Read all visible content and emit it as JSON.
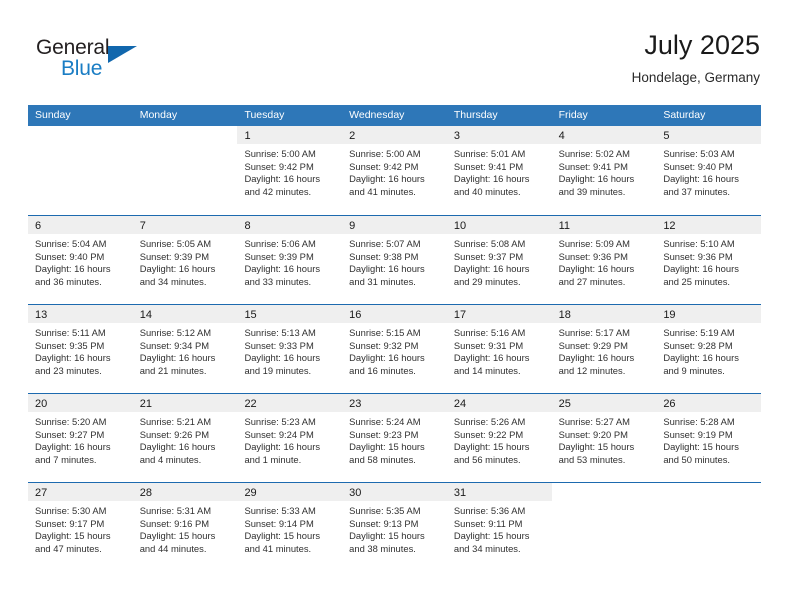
{
  "brand": {
    "name_top": "General",
    "name_bottom": "Blue",
    "accent_color": "#1a7dc4",
    "triangle_color": "#1167ad"
  },
  "header": {
    "title": "July 2025",
    "subtitle": "Hondelage, Germany"
  },
  "theme": {
    "header_blue": "#2e77b8",
    "rule_blue": "#1d6aaf",
    "daynum_band": "#efefef"
  },
  "labels": {
    "sunrise_prefix": "Sunrise:",
    "sunset_prefix": "Sunset:",
    "daylight_prefix": "Daylight:"
  },
  "weekdays": [
    "Sunday",
    "Monday",
    "Tuesday",
    "Wednesday",
    "Thursday",
    "Friday",
    "Saturday"
  ],
  "weeks": [
    [
      {
        "day": ""
      },
      {
        "day": ""
      },
      {
        "day": "1",
        "sunrise": "Sunrise: 5:00 AM",
        "sunset": "Sunset: 9:42 PM",
        "daylight": "Daylight: 16 hours and 42 minutes."
      },
      {
        "day": "2",
        "sunrise": "Sunrise: 5:00 AM",
        "sunset": "Sunset: 9:42 PM",
        "daylight": "Daylight: 16 hours and 41 minutes."
      },
      {
        "day": "3",
        "sunrise": "Sunrise: 5:01 AM",
        "sunset": "Sunset: 9:41 PM",
        "daylight": "Daylight: 16 hours and 40 minutes."
      },
      {
        "day": "4",
        "sunrise": "Sunrise: 5:02 AM",
        "sunset": "Sunset: 9:41 PM",
        "daylight": "Daylight: 16 hours and 39 minutes."
      },
      {
        "day": "5",
        "sunrise": "Sunrise: 5:03 AM",
        "sunset": "Sunset: 9:40 PM",
        "daylight": "Daylight: 16 hours and 37 minutes."
      }
    ],
    [
      {
        "day": "6",
        "sunrise": "Sunrise: 5:04 AM",
        "sunset": "Sunset: 9:40 PM",
        "daylight": "Daylight: 16 hours and 36 minutes."
      },
      {
        "day": "7",
        "sunrise": "Sunrise: 5:05 AM",
        "sunset": "Sunset: 9:39 PM",
        "daylight": "Daylight: 16 hours and 34 minutes."
      },
      {
        "day": "8",
        "sunrise": "Sunrise: 5:06 AM",
        "sunset": "Sunset: 9:39 PM",
        "daylight": "Daylight: 16 hours and 33 minutes."
      },
      {
        "day": "9",
        "sunrise": "Sunrise: 5:07 AM",
        "sunset": "Sunset: 9:38 PM",
        "daylight": "Daylight: 16 hours and 31 minutes."
      },
      {
        "day": "10",
        "sunrise": "Sunrise: 5:08 AM",
        "sunset": "Sunset: 9:37 PM",
        "daylight": "Daylight: 16 hours and 29 minutes."
      },
      {
        "day": "11",
        "sunrise": "Sunrise: 5:09 AM",
        "sunset": "Sunset: 9:36 PM",
        "daylight": "Daylight: 16 hours and 27 minutes."
      },
      {
        "day": "12",
        "sunrise": "Sunrise: 5:10 AM",
        "sunset": "Sunset: 9:36 PM",
        "daylight": "Daylight: 16 hours and 25 minutes."
      }
    ],
    [
      {
        "day": "13",
        "sunrise": "Sunrise: 5:11 AM",
        "sunset": "Sunset: 9:35 PM",
        "daylight": "Daylight: 16 hours and 23 minutes."
      },
      {
        "day": "14",
        "sunrise": "Sunrise: 5:12 AM",
        "sunset": "Sunset: 9:34 PM",
        "daylight": "Daylight: 16 hours and 21 minutes."
      },
      {
        "day": "15",
        "sunrise": "Sunrise: 5:13 AM",
        "sunset": "Sunset: 9:33 PM",
        "daylight": "Daylight: 16 hours and 19 minutes."
      },
      {
        "day": "16",
        "sunrise": "Sunrise: 5:15 AM",
        "sunset": "Sunset: 9:32 PM",
        "daylight": "Daylight: 16 hours and 16 minutes."
      },
      {
        "day": "17",
        "sunrise": "Sunrise: 5:16 AM",
        "sunset": "Sunset: 9:31 PM",
        "daylight": "Daylight: 16 hours and 14 minutes."
      },
      {
        "day": "18",
        "sunrise": "Sunrise: 5:17 AM",
        "sunset": "Sunset: 9:29 PM",
        "daylight": "Daylight: 16 hours and 12 minutes."
      },
      {
        "day": "19",
        "sunrise": "Sunrise: 5:19 AM",
        "sunset": "Sunset: 9:28 PM",
        "daylight": "Daylight: 16 hours and 9 minutes."
      }
    ],
    [
      {
        "day": "20",
        "sunrise": "Sunrise: 5:20 AM",
        "sunset": "Sunset: 9:27 PM",
        "daylight": "Daylight: 16 hours and 7 minutes."
      },
      {
        "day": "21",
        "sunrise": "Sunrise: 5:21 AM",
        "sunset": "Sunset: 9:26 PM",
        "daylight": "Daylight: 16 hours and 4 minutes."
      },
      {
        "day": "22",
        "sunrise": "Sunrise: 5:23 AM",
        "sunset": "Sunset: 9:24 PM",
        "daylight": "Daylight: 16 hours and 1 minute."
      },
      {
        "day": "23",
        "sunrise": "Sunrise: 5:24 AM",
        "sunset": "Sunset: 9:23 PM",
        "daylight": "Daylight: 15 hours and 58 minutes."
      },
      {
        "day": "24",
        "sunrise": "Sunrise: 5:26 AM",
        "sunset": "Sunset: 9:22 PM",
        "daylight": "Daylight: 15 hours and 56 minutes."
      },
      {
        "day": "25",
        "sunrise": "Sunrise: 5:27 AM",
        "sunset": "Sunset: 9:20 PM",
        "daylight": "Daylight: 15 hours and 53 minutes."
      },
      {
        "day": "26",
        "sunrise": "Sunrise: 5:28 AM",
        "sunset": "Sunset: 9:19 PM",
        "daylight": "Daylight: 15 hours and 50 minutes."
      }
    ],
    [
      {
        "day": "27",
        "sunrise": "Sunrise: 5:30 AM",
        "sunset": "Sunset: 9:17 PM",
        "daylight": "Daylight: 15 hours and 47 minutes."
      },
      {
        "day": "28",
        "sunrise": "Sunrise: 5:31 AM",
        "sunset": "Sunset: 9:16 PM",
        "daylight": "Daylight: 15 hours and 44 minutes."
      },
      {
        "day": "29",
        "sunrise": "Sunrise: 5:33 AM",
        "sunset": "Sunset: 9:14 PM",
        "daylight": "Daylight: 15 hours and 41 minutes."
      },
      {
        "day": "30",
        "sunrise": "Sunrise: 5:35 AM",
        "sunset": "Sunset: 9:13 PM",
        "daylight": "Daylight: 15 hours and 38 minutes."
      },
      {
        "day": "31",
        "sunrise": "Sunrise: 5:36 AM",
        "sunset": "Sunset: 9:11 PM",
        "daylight": "Daylight: 15 hours and 34 minutes."
      },
      {
        "day": ""
      },
      {
        "day": ""
      }
    ]
  ]
}
